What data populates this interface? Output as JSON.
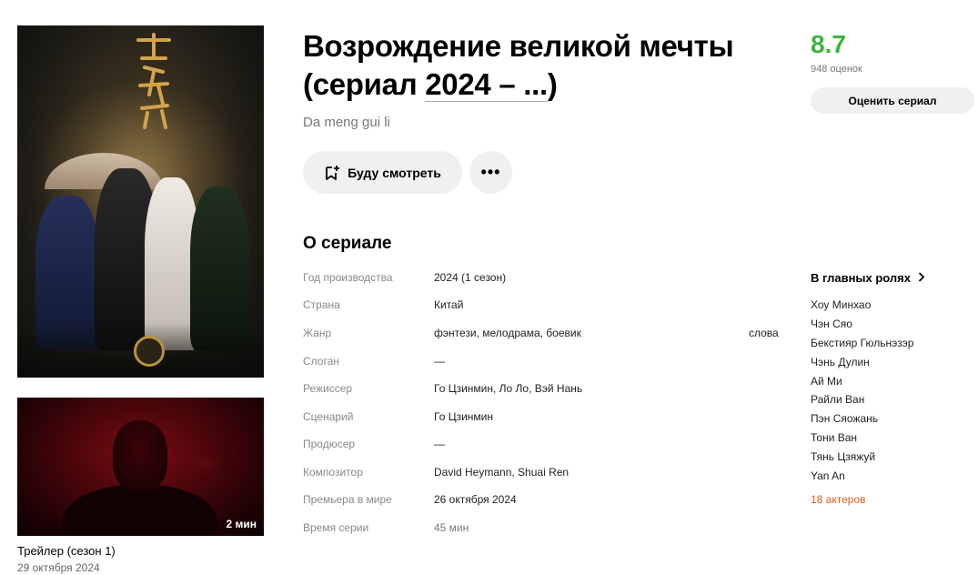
{
  "header": {
    "title": "Возрождение великой мечты (сериал ",
    "year_link": "2024 – ...",
    "title_close": ")",
    "original_title": "Da meng gui li"
  },
  "poster": {
    "title_art": "大梦归离"
  },
  "actions": {
    "watch_label": "Буду смотреть",
    "more_label": "•••"
  },
  "rating": {
    "value": "8.7",
    "votes": "948 оценок",
    "rate_label": "Оценить сериал",
    "color": "#3bb33b"
  },
  "trailer": {
    "duration": "2 мин",
    "title": "Трейлер (сезон 1)",
    "date": "29 октября 2024"
  },
  "about": {
    "section_title": "О сериале",
    "rows": [
      {
        "label": "Год производства",
        "value": "2024 (1 сезон)"
      },
      {
        "label": "Страна",
        "value": "Китай"
      },
      {
        "label": "Жанр",
        "value": "фэнтези, мелодрама, боевик",
        "extra": "слова"
      },
      {
        "label": "Слоган",
        "value": "—"
      },
      {
        "label": "Режиссер",
        "value": "Го Цзинмин, Ло Ло, Вэй Нань"
      },
      {
        "label": "Сценарий",
        "value": "Го Цзинмин"
      },
      {
        "label": "Продюсер",
        "value": "—"
      },
      {
        "label": "Композитор",
        "value": "David Heymann, Shuai Ren"
      },
      {
        "label": "Премьера в мире",
        "value": "26 октября 2024"
      },
      {
        "label": "Время серии",
        "value": "45 мин"
      }
    ]
  },
  "cast": {
    "title": "В главных ролях",
    "actors": [
      "Хоу Минхао",
      "Чэн Сяо",
      "Бекстияр Гюльнэзэр",
      "Чэнь Дулин",
      "Ай Ми",
      "Райли Ван",
      "Пэн Сяожань",
      "Тони Ван",
      "Тянь Цзяжуй",
      "Yan An"
    ],
    "more_label": "18 актеров",
    "more_color": "#e05d1a"
  }
}
